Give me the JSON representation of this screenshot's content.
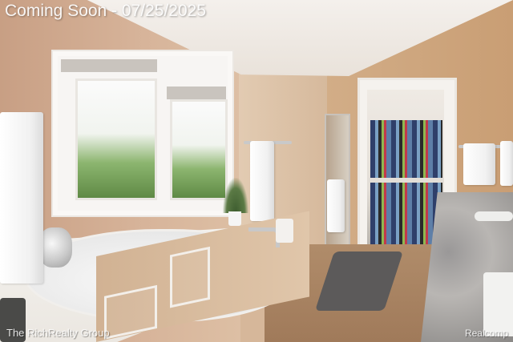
{
  "banner": {
    "text": "Coming Soon - 07/25/2025"
  },
  "watermarks": {
    "brokerage": "The RichRealty Group",
    "source": "Realcomp"
  },
  "colors": {
    "wall": "#d7b49a",
    "wall_right": "#c99e74",
    "tub": "#f4f2ee",
    "floor_tile": "#a88462",
    "rug": "#5c5a5a",
    "counter": "#a9a6a3"
  }
}
